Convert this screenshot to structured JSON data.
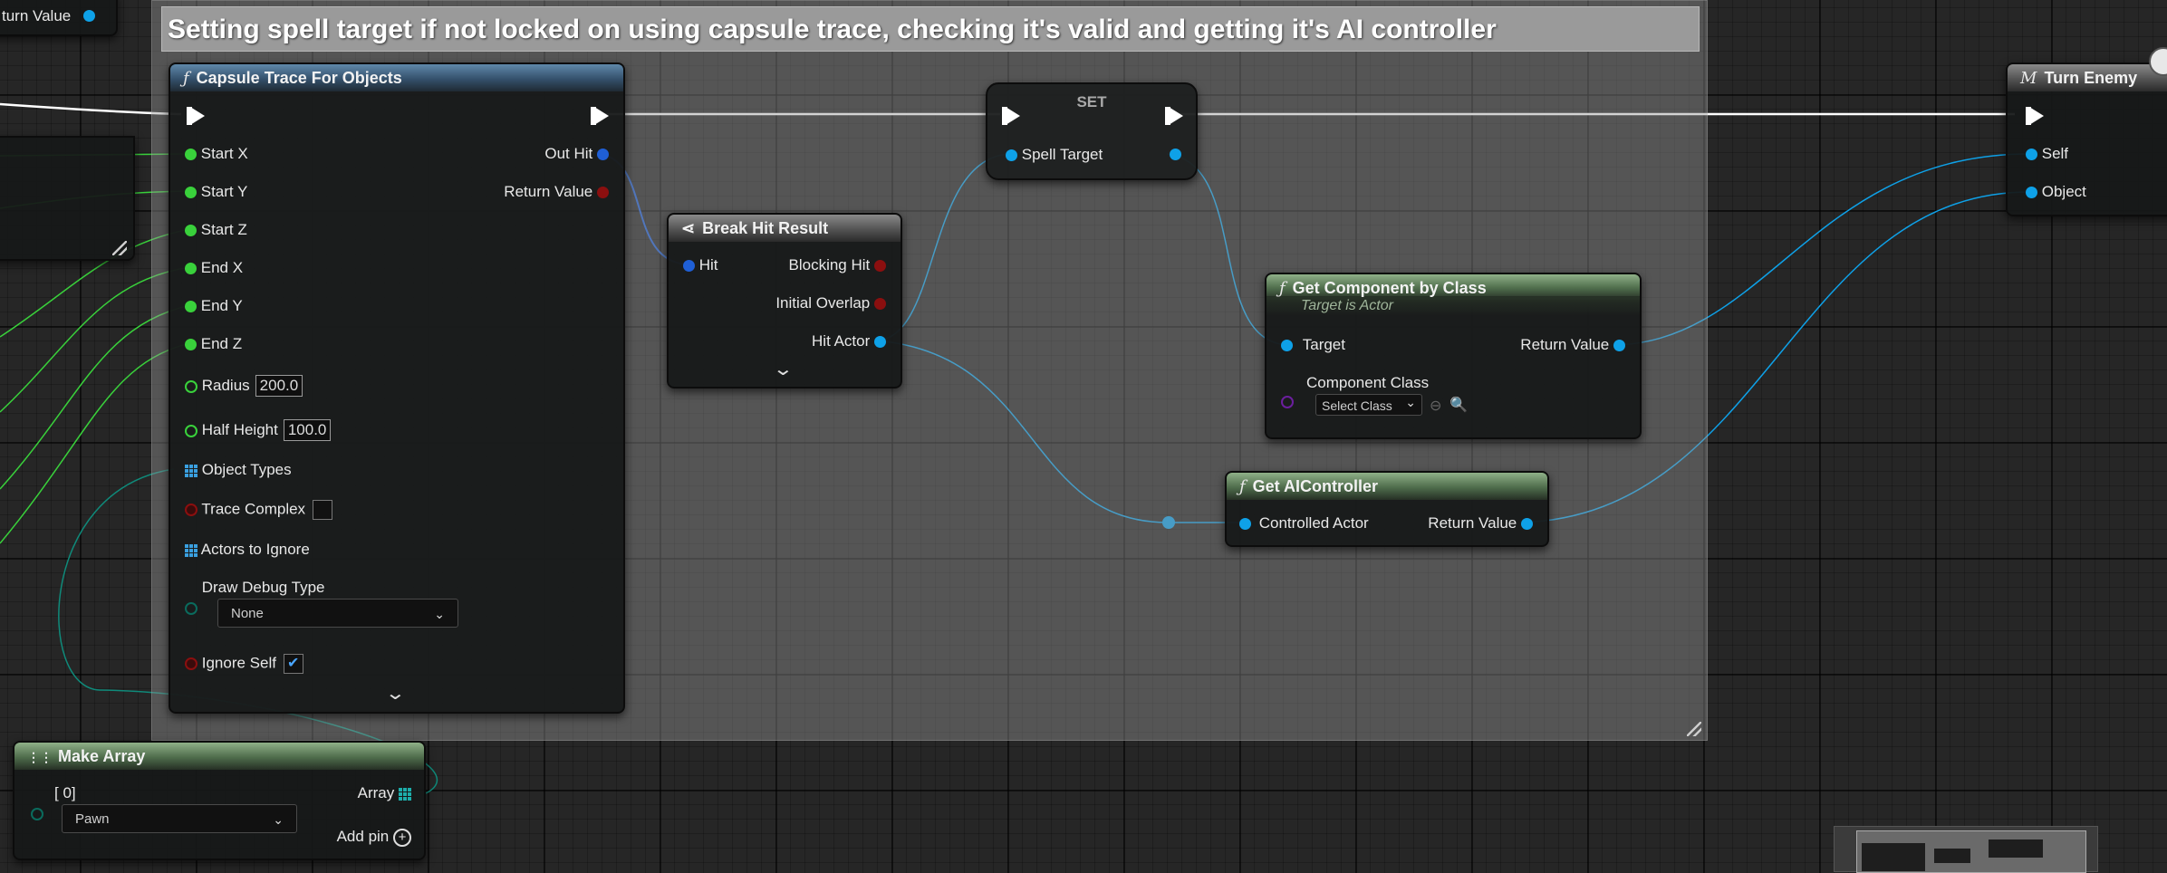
{
  "comment": {
    "title": "Setting spell target if not locked on using capsule trace, checking it's valid and getting it's AI controller"
  },
  "offscreen_node": {
    "return_label": "turn Value"
  },
  "capsule_trace": {
    "title": "Capsule Trace For Objects",
    "inputs": {
      "start_x": "Start X",
      "start_y": "Start Y",
      "start_z": "Start Z",
      "end_x": "End X",
      "end_y": "End Y",
      "end_z": "End Z",
      "radius_label": "Radius",
      "radius_value": "200.0",
      "half_height_label": "Half Height",
      "half_height_value": "100.0",
      "object_types": "Object Types",
      "trace_complex": "Trace Complex",
      "actors_to_ignore": "Actors to Ignore",
      "draw_debug_type": "Draw Debug Type",
      "draw_debug_value": "None",
      "ignore_self": "Ignore Self"
    },
    "outputs": {
      "out_hit": "Out Hit",
      "return_value": "Return Value"
    },
    "trace_complex_checked": false,
    "ignore_self_checked": true
  },
  "break_hit": {
    "title": "Break Hit Result",
    "input": "Hit",
    "outputs": {
      "blocking_hit": "Blocking Hit",
      "initial_overlap": "Initial Overlap",
      "hit_actor": "Hit Actor"
    }
  },
  "set_node": {
    "title": "SET",
    "pin": "Spell Target"
  },
  "get_component": {
    "title": "Get Component by Class",
    "subtitle": "Target is Actor",
    "target": "Target",
    "return_value": "Return Value",
    "component_class": "Component Class",
    "select_class": "Select Class"
  },
  "get_ai": {
    "title": "Get AIController",
    "input": "Controlled Actor",
    "return_value": "Return Value"
  },
  "turn_enemy": {
    "title": "Turn Enemy",
    "self": "Self",
    "object": "Object"
  },
  "make_array": {
    "title": "Make Array",
    "index": "[ 0]",
    "value": "Pawn",
    "output": "Array",
    "add_pin": "Add pin"
  },
  "colors": {
    "float_pin": "#39d13b",
    "struct_pin": "#1f5fd6",
    "object_pin": "#0ea1e8",
    "bool_pin": "#8b0f0f",
    "class_pin": "#6b1f9e",
    "enum_pin": "#0a6b5d",
    "exec_wire": "#ffffff"
  }
}
